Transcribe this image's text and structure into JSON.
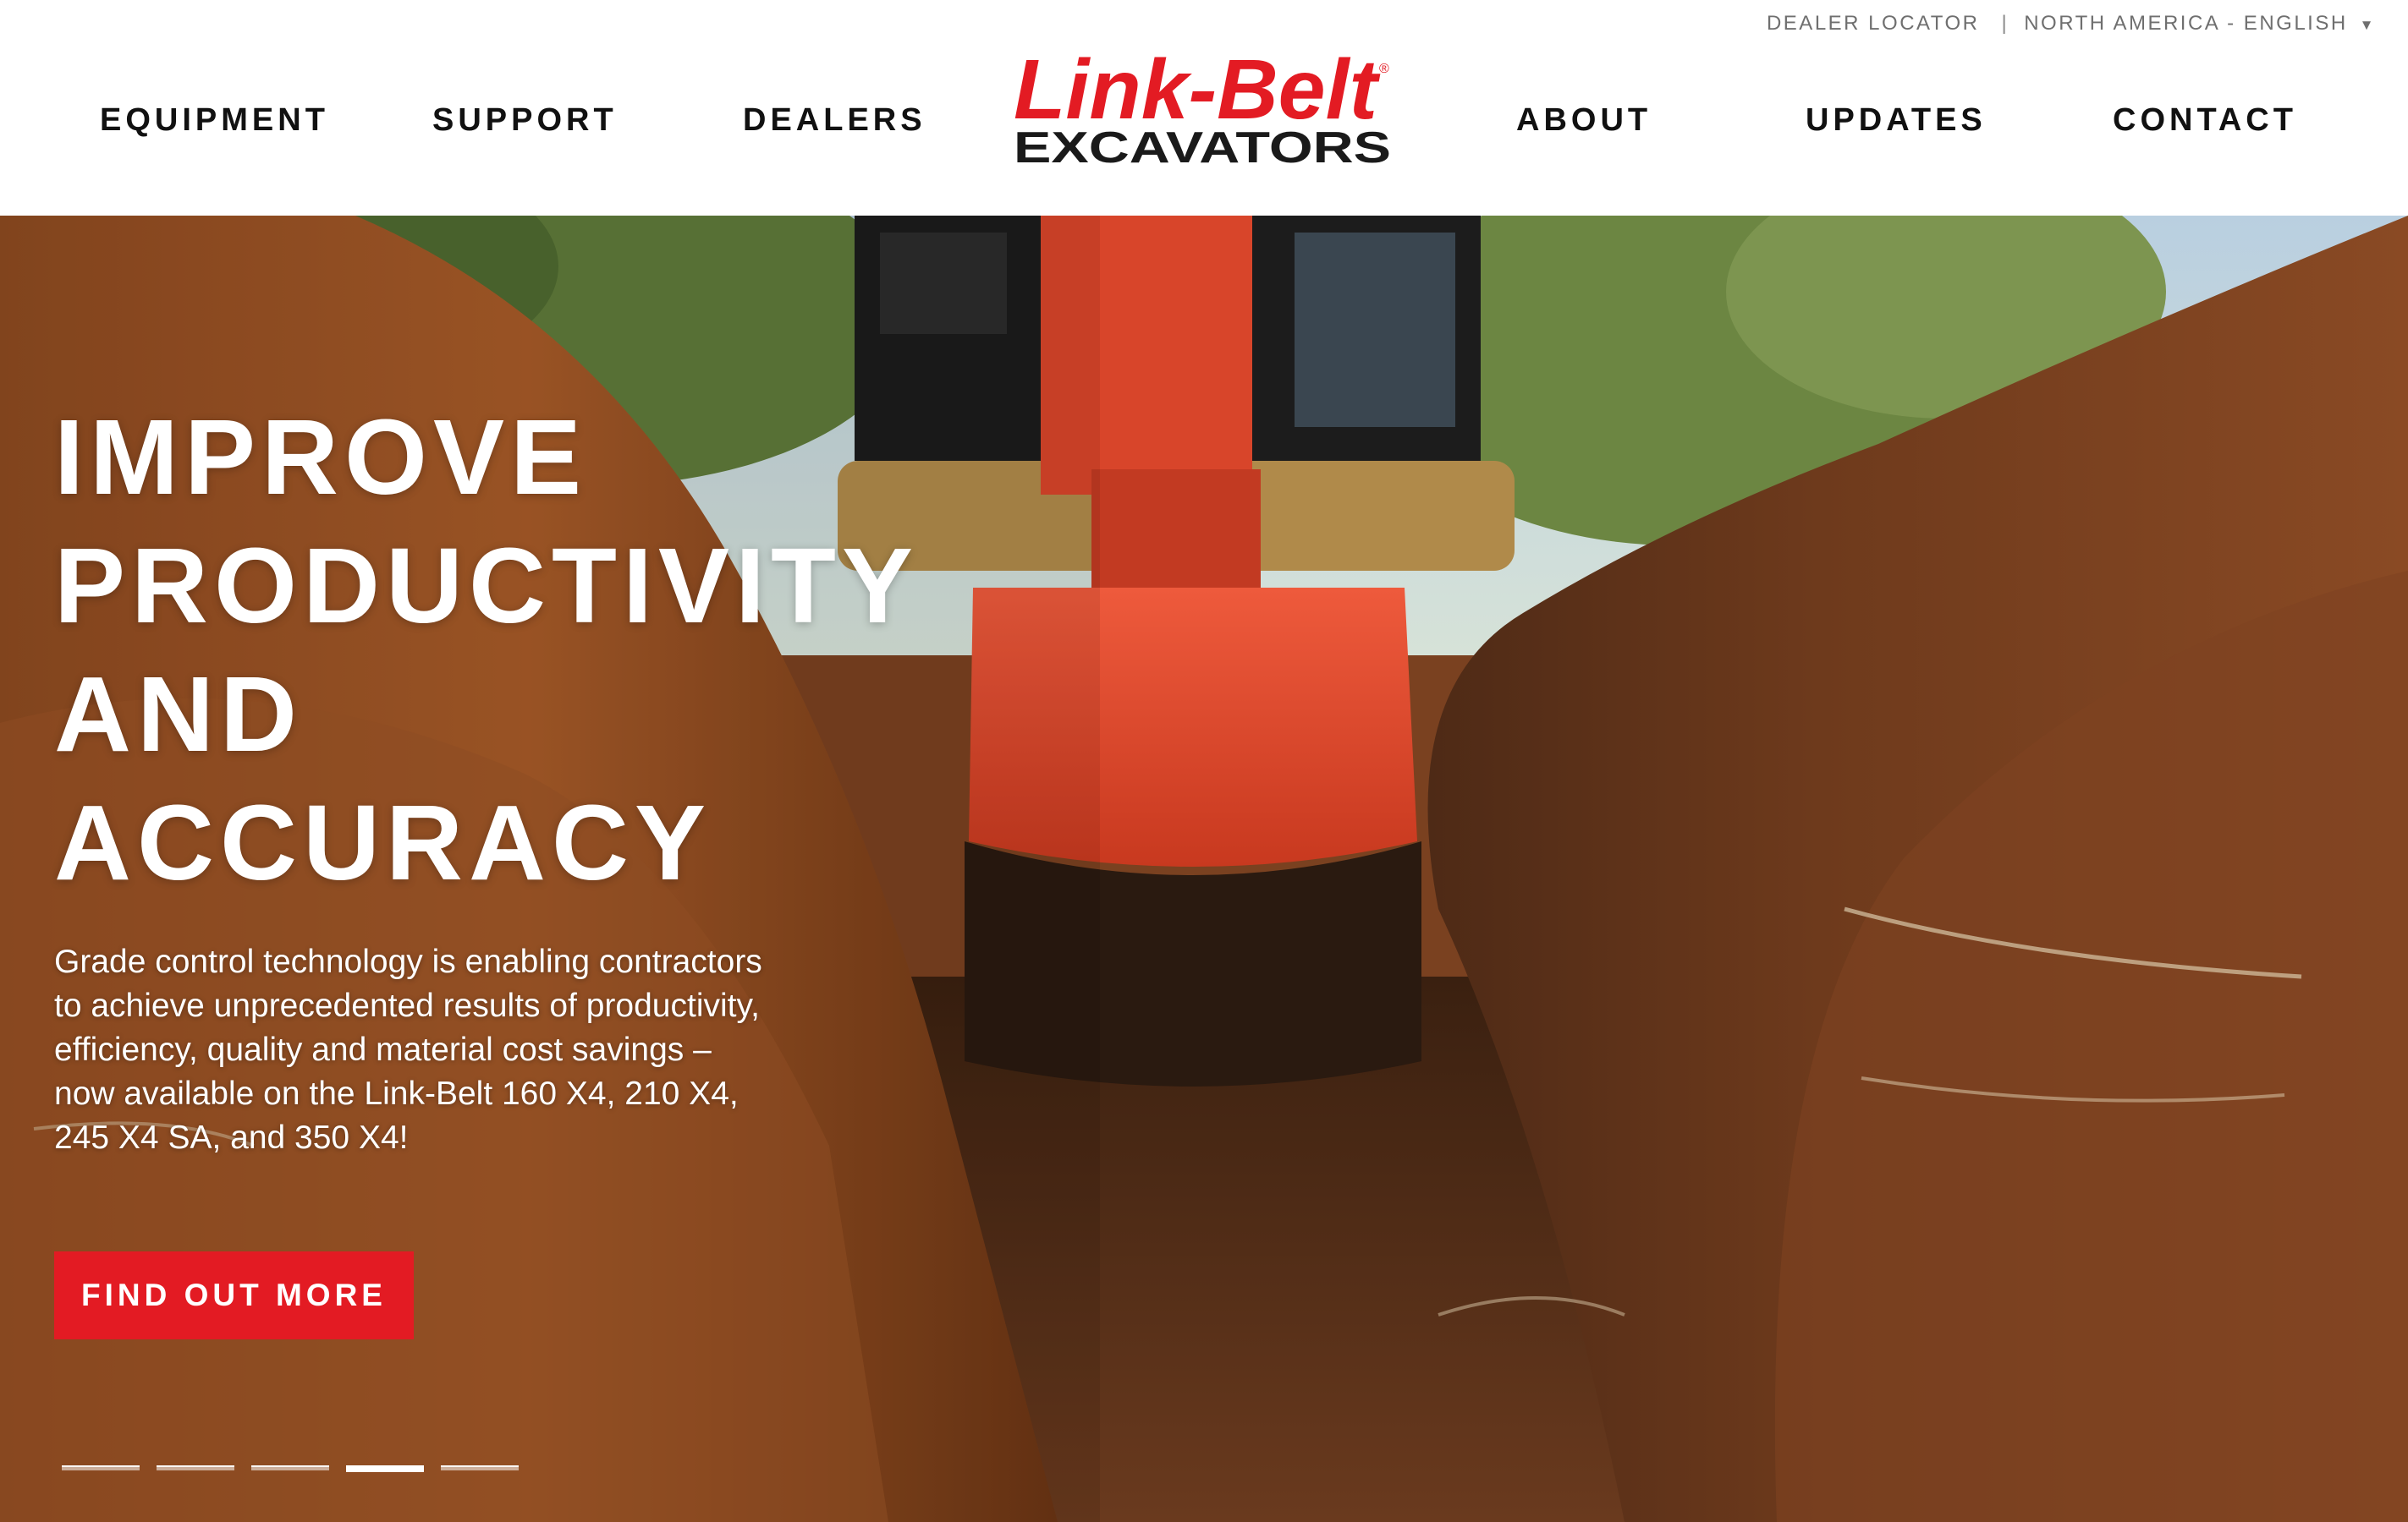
{
  "utility": {
    "dealer_locator": "DEALER LOCATOR",
    "separator": "|",
    "region": "NORTH AMERICA - ENGLISH",
    "region_caret": "▼"
  },
  "nav": {
    "left": [
      "EQUIPMENT",
      "SUPPORT",
      "DEALERS"
    ],
    "right": [
      "ABOUT",
      "UPDATES",
      "CONTACT"
    ]
  },
  "logo": {
    "brand": "Link-Belt",
    "registered": "®",
    "product": "EXCAVATORS",
    "brand_color": "#e31b23",
    "product_color": "#1a1a1a"
  },
  "hero": {
    "headline_lines": [
      "IMPROVE",
      "PRODUCTIVITY",
      "AND",
      "ACCURACY"
    ],
    "body": "Grade control technology is enabling contractors to achieve unprecedented results of productivity, efficiency, quality and material cost savings – now available on the Link-Belt 160 X4, 210 X4, 245 X4 SA, and 350 X4!",
    "cta_label": "FIND OUT MORE",
    "cta_color": "#e31b23",
    "slide_count": 5,
    "active_slide": 4
  }
}
